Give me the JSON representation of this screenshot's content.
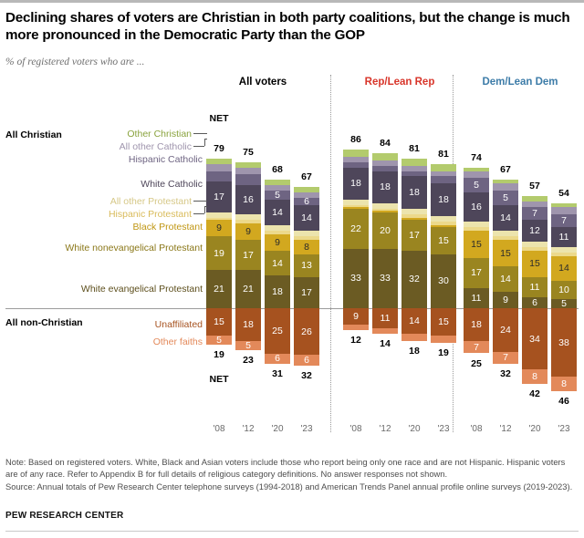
{
  "header": {
    "title": "Declining shares of voters are Christian in both party coalitions, but the change is much more pronounced in the Democratic Party than the GOP",
    "subtitle": "% of registered voters who are ..."
  },
  "labels": {
    "all_christian": "All Christian",
    "all_non_christian": "All non-Christian",
    "net_top": "NET",
    "net_bottom": "NET"
  },
  "footer": {
    "note": "Note: Based on registered voters. White, Black and Asian voters include those who report being only one race and are not Hispanic. Hispanic voters are of any race. Refer to Appendix B for full details of religious category definitions. No answer responses not shown.",
    "source": "Source: Annual totals of Pew Research Center telephone surveys (1994-2018) and American Trends Panel annual profile online surveys (2019-2023).",
    "brand": "PEW RESEARCH CENTER"
  },
  "chart_data": {
    "type": "bar",
    "title": "Declining shares of voters are Christian in both party coalitions, but the change is much more pronounced in the Democratic Party than the GOP",
    "subtitle": "% of registered voters who are ...",
    "xlabel": "",
    "ylabel": "% of registered voters",
    "grid": false,
    "legend_position": "left-labels",
    "stacked": "diverging",
    "categories": [
      "'08",
      "'12",
      "'20",
      "'23"
    ],
    "groups": [
      {
        "name": "All voters",
        "color": "#000000"
      },
      {
        "name": "Rep/Lean Rep",
        "color": "#d8352a"
      },
      {
        "name": "Dem/Lean Dem",
        "color": "#3d7ca8"
      }
    ],
    "series": [
      {
        "name": "Other Christian",
        "color": "#b3cb6d",
        "side": "up",
        "label_color": "#8aa33e",
        "values": {
          "All voters": [
            3,
            3,
            3,
            3
          ],
          "Rep/Lean Rep": [
            4,
            4,
            4,
            4
          ],
          "Dem/Lean Dem": [
            2,
            2,
            3,
            2
          ]
        }
      },
      {
        "name": "All other Catholic",
        "color": "#9f95ad",
        "side": "up",
        "label_color": "#9f95ad",
        "values": {
          "All voters": [
            4,
            4,
            3,
            3
          ],
          "Rep/Lean Rep": [
            3,
            3,
            3,
            3
          ],
          "Dem/Lean Dem": [
            4,
            4,
            3,
            4
          ]
        }
      },
      {
        "name": "Hispanic Catholic",
        "color": "#6e6482",
        "side": "up",
        "label_color": "#6e6482",
        "values": {
          "All voters": [
            6,
            6,
            5,
            4
          ],
          "Rep/Lean Rep": [
            3,
            3,
            3,
            4
          ],
          "Dem/Lean Dem": [
            8,
            8,
            7,
            7
          ]
        }
      },
      {
        "name": "White Catholic",
        "color": "#4e465a",
        "side": "up",
        "label_color": "#4e465a",
        "values": {
          "All voters": [
            17,
            16,
            14,
            14
          ],
          "Rep/Lean Rep": [
            18,
            18,
            18,
            18
          ],
          "Dem/Lean Dem": [
            16,
            14,
            12,
            11
          ]
        }
      },
      {
        "name": "All other Protestant",
        "color": "#ece4ad",
        "side": "up",
        "label_color": "#d6c887",
        "values": {
          "All voters": [
            3,
            3,
            3,
            3
          ],
          "Rep/Lean Rep": [
            3,
            3,
            3,
            3
          ],
          "Dem/Lean Dem": [
            3,
            3,
            3,
            3
          ]
        }
      },
      {
        "name": "Hispanic Protestant",
        "color": "#ecd98b",
        "side": "up",
        "label_color": "#d9bb5a",
        "values": {
          "All voters": [
            1,
            2,
            2,
            2
          ],
          "Rep/Lean Rep": [
            1,
            1,
            2,
            2
          ],
          "Dem/Lean Dem": [
            2,
            2,
            2,
            2
          ]
        }
      },
      {
        "name": "Black Protestant",
        "color": "#d2a81f",
        "side": "up",
        "label_color": "#c09613",
        "values": {
          "All voters": [
            9,
            9,
            9,
            8
          ],
          "Rep/Lean Rep": [
            1,
            1,
            1,
            1
          ],
          "Dem/Lean Dem": [
            15,
            15,
            15,
            14
          ]
        }
      },
      {
        "name": "White nonevangelical Protestant",
        "color": "#9a8520",
        "side": "up",
        "label_color": "#8a7718",
        "values": {
          "All voters": [
            19,
            17,
            14,
            13
          ],
          "Rep/Lean Rep": [
            22,
            20,
            17,
            15
          ],
          "Dem/Lean Dem": [
            17,
            14,
            11,
            10
          ]
        }
      },
      {
        "name": "White evangelical Protestant",
        "color": "#6b5b23",
        "side": "up",
        "label_color": "#5d4f1d",
        "values": {
          "All voters": [
            21,
            21,
            18,
            17
          ],
          "Rep/Lean Rep": [
            33,
            33,
            32,
            30
          ],
          "Dem/Lean Dem": [
            11,
            9,
            6,
            5
          ]
        }
      },
      {
        "name": "Unaffiliated",
        "color": "#a6521f",
        "side": "down",
        "label_color": "#a6521f",
        "values": {
          "All voters": [
            15,
            18,
            25,
            26
          ],
          "Rep/Lean Rep": [
            9,
            11,
            14,
            15
          ],
          "Dem/Lean Dem": [
            18,
            24,
            34,
            38
          ]
        }
      },
      {
        "name": "Other faiths",
        "color": "#e3895a",
        "side": "down",
        "label_color": "#e3895a",
        "values": {
          "All voters": [
            5,
            5,
            6,
            6
          ],
          "Rep/Lean Rep": [
            3,
            3,
            4,
            4
          ],
          "Dem/Lean Dem": [
            7,
            7,
            8,
            8
          ]
        }
      }
    ],
    "net_christian": {
      "All voters": [
        79,
        75,
        68,
        67
      ],
      "Rep/Lean Rep": [
        86,
        84,
        81,
        81
      ],
      "Dem/Lean Dem": [
        74,
        67,
        57,
        54
      ]
    },
    "net_non_christian": {
      "All voters": [
        19,
        23,
        31,
        32
      ],
      "Rep/Lean Rep": [
        12,
        14,
        18,
        19
      ],
      "Dem/Lean Dem": [
        25,
        32,
        42,
        46
      ]
    },
    "displayed_segment_labels": {
      "All voters": {
        "'08": {
          "White Catholic": "17",
          "Black Protestant": "9",
          "White nonevangelical Protestant": "19",
          "White evangelical Protestant": "21",
          "Unaffiliated": "15",
          "Other faiths": "5"
        },
        "'12": {
          "White Catholic": "16",
          "Black Protestant": "9",
          "White nonevangelical Protestant": "17",
          "White evangelical Protestant": "21",
          "Unaffiliated": "18",
          "Other faiths": "5"
        },
        "'20": {
          "Hispanic Catholic": "5",
          "White Catholic": "14",
          "Black Protestant": "9",
          "White nonevangelical Protestant": "14",
          "White evangelical Protestant": "18",
          "Unaffiliated": "25",
          "Other faiths": "6"
        },
        "'23": {
          "Hispanic Catholic": "6",
          "White Catholic": "14",
          "Black Protestant": "8",
          "White nonevangelical Protestant": "13",
          "White evangelical Protestant": "17",
          "Unaffiliated": "26",
          "Other faiths": "6"
        }
      },
      "Rep/Lean Rep": {
        "'08": {
          "White Catholic": "18",
          "White nonevangelical Protestant": "22",
          "White evangelical Protestant": "33",
          "Unaffiliated": "9"
        },
        "'12": {
          "White Catholic": "18",
          "White nonevangelical Protestant": "20",
          "White evangelical Protestant": "33",
          "Unaffiliated": "11"
        },
        "'20": {
          "White Catholic": "18",
          "White nonevangelical Protestant": "17",
          "White evangelical Protestant": "32",
          "Unaffiliated": "14"
        },
        "'23": {
          "White Catholic": "18",
          "White nonevangelical Protestant": "15",
          "White evangelical Protestant": "30",
          "Unaffiliated": "15"
        }
      },
      "Dem/Lean Dem": {
        "'08": {
          "Hispanic Catholic": "5",
          "White Catholic": "16",
          "Black Protestant": "15",
          "White nonevangelical Protestant": "17",
          "White evangelical Protestant": "11",
          "Unaffiliated": "18",
          "Other faiths": "7"
        },
        "'12": {
          "Hispanic Catholic": "5",
          "White Catholic": "14",
          "Black Protestant": "15",
          "White nonevangelical Protestant": "14",
          "White evangelical Protestant": "9",
          "Unaffiliated": "24",
          "Other faiths": "7"
        },
        "'20": {
          "Hispanic Catholic": "7",
          "White Catholic": "12",
          "Black Protestant": "15",
          "White nonevangelical Protestant": "11",
          "White evangelical Protestant": "6",
          "Unaffiliated": "34",
          "Other faiths": "8"
        },
        "'23": {
          "Hispanic Catholic": "7",
          "White Catholic": "11",
          "Black Protestant": "14",
          "White nonevangelical Protestant": "10",
          "White evangelical Protestant": "5",
          "Unaffiliated": "38",
          "Other faiths": "8"
        }
      }
    }
  }
}
